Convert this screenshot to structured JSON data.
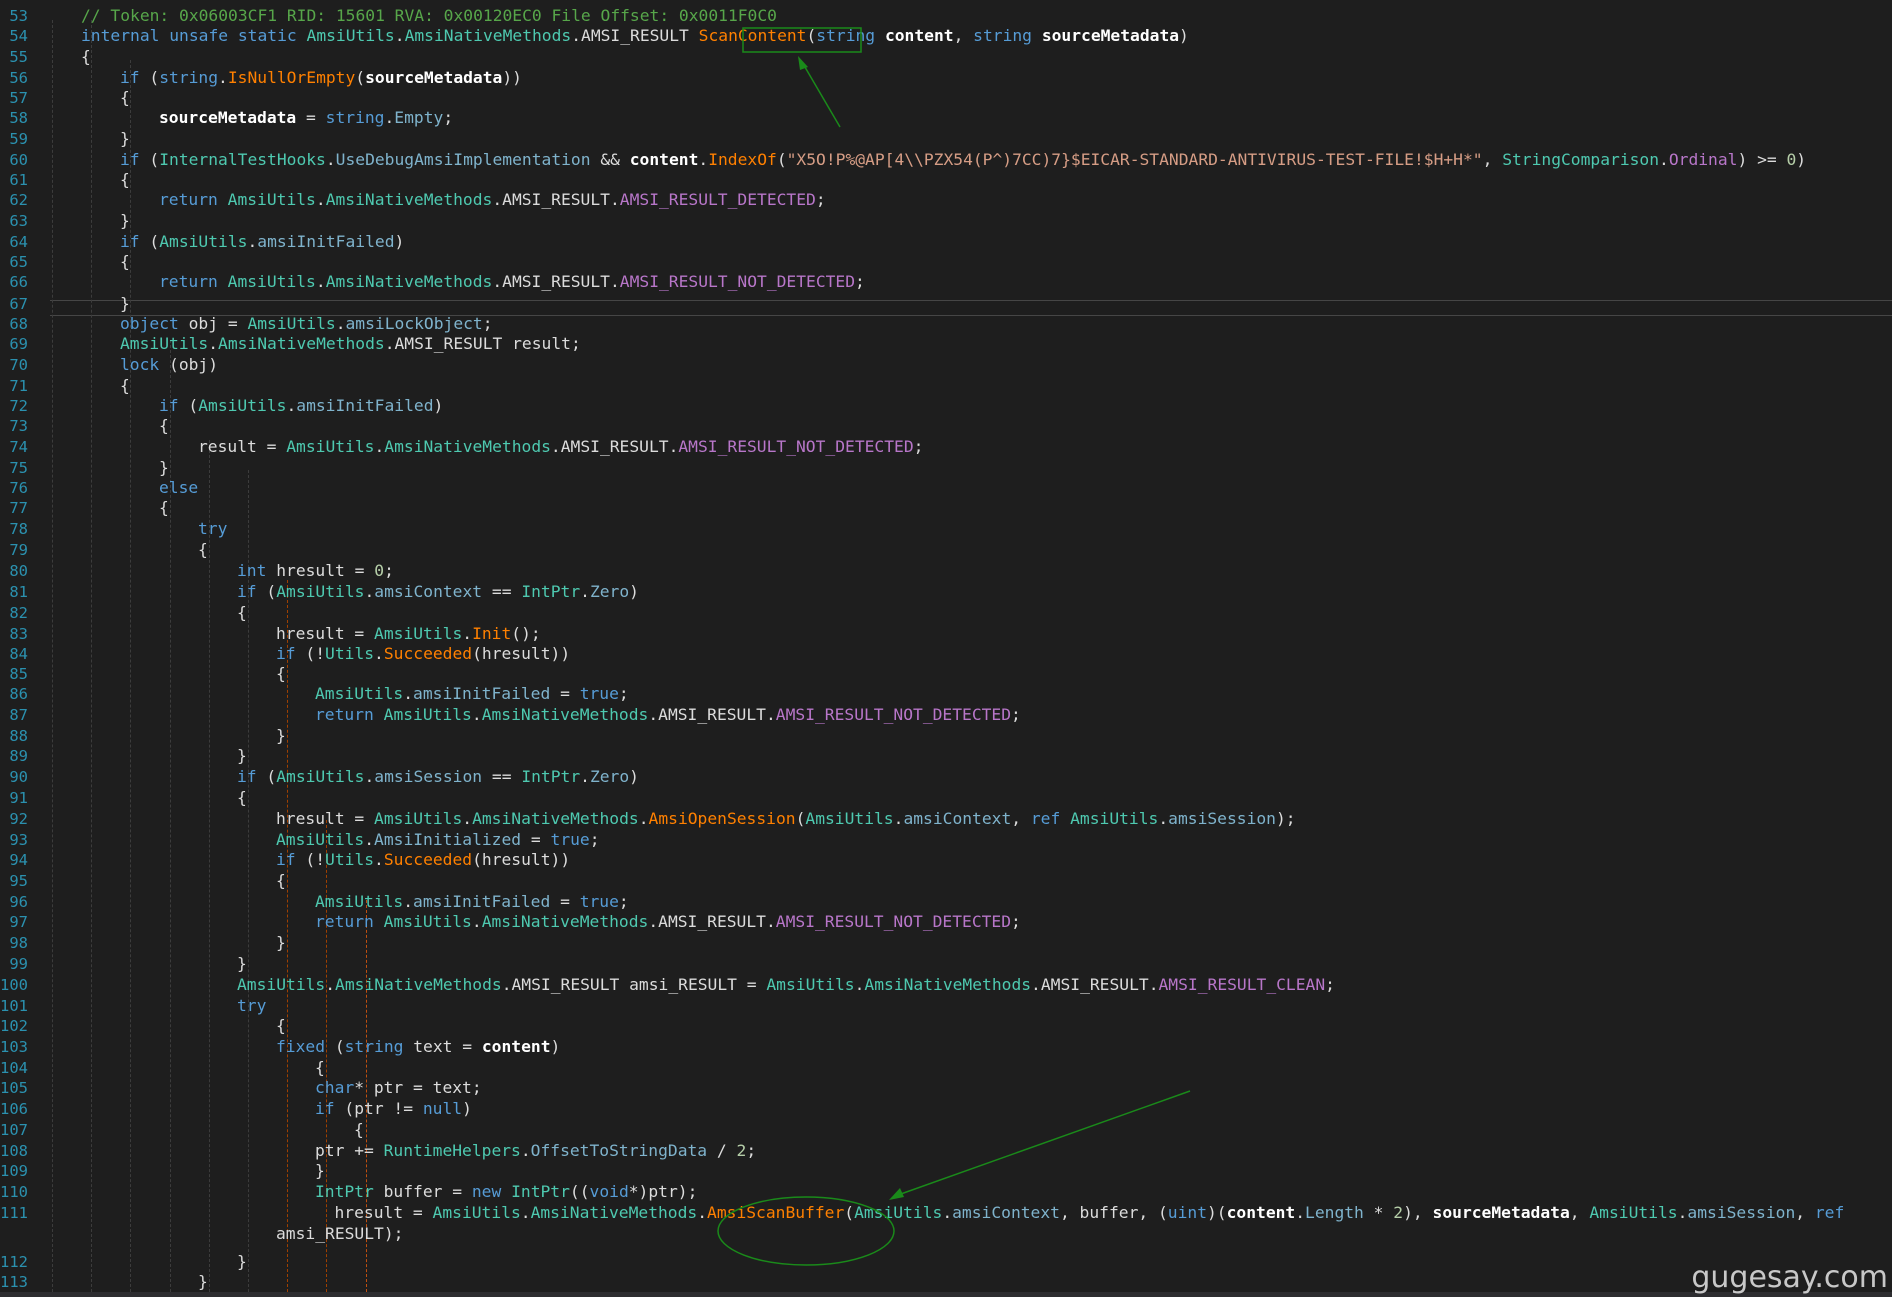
{
  "editor": {
    "line_numbers": [
      "53",
      "54",
      "55",
      "56",
      "57",
      "58",
      "59",
      "60",
      "61",
      "62",
      "63",
      "64",
      "65",
      "66",
      "67",
      "68",
      "69",
      "70",
      "71",
      "72",
      "73",
      "74",
      "75",
      "76",
      "77",
      "78",
      "79",
      "80",
      "81",
      "82",
      "83",
      "84",
      "85",
      "86",
      "87",
      "88",
      "89",
      "90",
      "91",
      "92",
      "93",
      "94",
      "95",
      "96",
      "97",
      "98",
      "99",
      "100",
      "101",
      "102",
      "103",
      "104",
      "105",
      "106",
      "107",
      "108",
      "109",
      "110",
      "111",
      "",
      "112",
      "113"
    ],
    "lines": [
      [
        [
          "cmt",
          "// Token: 0x06003CF1 RID: 15601 RVA: 0x00120EC0 File Offset: 0x0011F0C0"
        ]
      ],
      [
        [
          "kw",
          "internal"
        ],
        [
          "plain",
          " "
        ],
        [
          "kw",
          "unsafe"
        ],
        [
          "plain",
          " "
        ],
        [
          "kw",
          "static"
        ],
        [
          "plain",
          " "
        ],
        [
          "type",
          "AmsiUtils"
        ],
        [
          "plain",
          "."
        ],
        [
          "type",
          "AmsiNativeMethods"
        ],
        [
          "plain",
          "."
        ],
        [
          "plain",
          "AMSI_RESULT "
        ],
        [
          "meth",
          "ScanContent"
        ],
        [
          "plain",
          "("
        ],
        [
          "kw",
          "string"
        ],
        [
          "plain",
          " "
        ],
        [
          "bold",
          "content"
        ],
        [
          "plain",
          ", "
        ],
        [
          "kw",
          "string"
        ],
        [
          "plain",
          " "
        ],
        [
          "bold",
          "sourceMetadata"
        ],
        [
          "plain",
          ")"
        ]
      ],
      [
        [
          "plain",
          "{"
        ]
      ],
      [
        [
          "kw",
          "if"
        ],
        [
          "plain",
          " ("
        ],
        [
          "kw",
          "string"
        ],
        [
          "plain",
          "."
        ],
        [
          "meth",
          "IsNullOrEmpty"
        ],
        [
          "plain",
          "("
        ],
        [
          "bold",
          "sourceMetadata"
        ],
        [
          "plain",
          "))"
        ]
      ],
      [
        [
          "plain",
          "{"
        ]
      ],
      [
        [
          "bold",
          "sourceMetadata"
        ],
        [
          "plain",
          " = "
        ],
        [
          "kw",
          "string"
        ],
        [
          "plain",
          "."
        ],
        [
          "fld",
          "Empty"
        ],
        [
          "plain",
          ";"
        ]
      ],
      [
        [
          "plain",
          "}"
        ]
      ],
      [
        [
          "kw",
          "if"
        ],
        [
          "plain",
          " ("
        ],
        [
          "type",
          "InternalTestHooks"
        ],
        [
          "plain",
          "."
        ],
        [
          "fld",
          "UseDebugAmsiImplementation"
        ],
        [
          "plain",
          " && "
        ],
        [
          "bold",
          "content"
        ],
        [
          "plain",
          "."
        ],
        [
          "meth",
          "IndexOf"
        ],
        [
          "plain",
          "("
        ],
        [
          "str",
          "\"X5O!P%@AP[4\\\\PZX54(P^)7CC)7}$EICAR-STANDARD-ANTIVIRUS-TEST-FILE!$H+H*\""
        ],
        [
          "plain",
          ", "
        ],
        [
          "type",
          "StringComparison"
        ],
        [
          "plain",
          "."
        ],
        [
          "en",
          "Ordinal"
        ],
        [
          "plain",
          ") >= "
        ],
        [
          "num",
          "0"
        ],
        [
          "plain",
          ")"
        ]
      ],
      [
        [
          "plain",
          "{"
        ]
      ],
      [
        [
          "kw",
          "return"
        ],
        [
          "plain",
          " "
        ],
        [
          "type",
          "AmsiUtils"
        ],
        [
          "plain",
          "."
        ],
        [
          "type",
          "AmsiNativeMethods"
        ],
        [
          "plain",
          "."
        ],
        [
          "plain",
          "AMSI_RESULT"
        ],
        [
          "plain",
          "."
        ],
        [
          "en",
          "AMSI_RESULT_DETECTED"
        ],
        [
          "plain",
          ";"
        ]
      ],
      [
        [
          "plain",
          "}"
        ]
      ],
      [
        [
          "kw",
          "if"
        ],
        [
          "plain",
          " ("
        ],
        [
          "type",
          "AmsiUtils"
        ],
        [
          "plain",
          "."
        ],
        [
          "fld",
          "amsiInitFailed"
        ],
        [
          "plain",
          ")"
        ]
      ],
      [
        [
          "plain",
          "{"
        ]
      ],
      [
        [
          "kw",
          "return"
        ],
        [
          "plain",
          " "
        ],
        [
          "type",
          "AmsiUtils"
        ],
        [
          "plain",
          "."
        ],
        [
          "type",
          "AmsiNativeMethods"
        ],
        [
          "plain",
          "."
        ],
        [
          "plain",
          "AMSI_RESULT"
        ],
        [
          "plain",
          "."
        ],
        [
          "en",
          "AMSI_RESULT_NOT_DETECTED"
        ],
        [
          "plain",
          ";"
        ]
      ],
      [
        [
          "plain",
          "}"
        ]
      ],
      [
        [
          "kw",
          "object"
        ],
        [
          "plain",
          " obj = "
        ],
        [
          "type",
          "AmsiUtils"
        ],
        [
          "plain",
          "."
        ],
        [
          "fld",
          "amsiLockObject"
        ],
        [
          "plain",
          ";"
        ]
      ],
      [
        [
          "type",
          "AmsiUtils"
        ],
        [
          "plain",
          "."
        ],
        [
          "type",
          "AmsiNativeMethods"
        ],
        [
          "plain",
          "."
        ],
        [
          "plain",
          "AMSI_RESULT result;"
        ]
      ],
      [
        [
          "kw",
          "lock"
        ],
        [
          "plain",
          " (obj)"
        ]
      ],
      [
        [
          "plain",
          "{"
        ]
      ],
      [
        [
          "kw",
          "if"
        ],
        [
          "plain",
          " ("
        ],
        [
          "type",
          "AmsiUtils"
        ],
        [
          "plain",
          "."
        ],
        [
          "fld",
          "amsiInitFailed"
        ],
        [
          "plain",
          ")"
        ]
      ],
      [
        [
          "plain",
          "{"
        ]
      ],
      [
        [
          "plain",
          "result = "
        ],
        [
          "type",
          "AmsiUtils"
        ],
        [
          "plain",
          "."
        ],
        [
          "type",
          "AmsiNativeMethods"
        ],
        [
          "plain",
          "."
        ],
        [
          "plain",
          "AMSI_RESULT"
        ],
        [
          "plain",
          "."
        ],
        [
          "en",
          "AMSI_RESULT_NOT_DETECTED"
        ],
        [
          "plain",
          ";"
        ]
      ],
      [
        [
          "plain",
          "}"
        ]
      ],
      [
        [
          "kw",
          "else"
        ]
      ],
      [
        [
          "plain",
          "{"
        ]
      ],
      [
        [
          "kw",
          "try"
        ]
      ],
      [
        [
          "plain",
          "{"
        ]
      ],
      [
        [
          "kw",
          "int"
        ],
        [
          "plain",
          " hresult = "
        ],
        [
          "num",
          "0"
        ],
        [
          "plain",
          ";"
        ]
      ],
      [
        [
          "kw",
          "if"
        ],
        [
          "plain",
          " ("
        ],
        [
          "type",
          "AmsiUtils"
        ],
        [
          "plain",
          "."
        ],
        [
          "fld",
          "amsiContext"
        ],
        [
          "plain",
          " == "
        ],
        [
          "ref",
          "IntPtr"
        ],
        [
          "plain",
          "."
        ],
        [
          "fld",
          "Zero"
        ],
        [
          "plain",
          ")"
        ]
      ],
      [
        [
          "plain",
          "{"
        ]
      ],
      [
        [
          "plain",
          "hresult = "
        ],
        [
          "type",
          "AmsiUtils"
        ],
        [
          "plain",
          "."
        ],
        [
          "meth",
          "Init"
        ],
        [
          "plain",
          "();"
        ]
      ],
      [
        [
          "kw",
          "if"
        ],
        [
          "plain",
          " (!"
        ],
        [
          "type",
          "Utils"
        ],
        [
          "plain",
          "."
        ],
        [
          "meth",
          "Succeeded"
        ],
        [
          "plain",
          "(hresult))"
        ]
      ],
      [
        [
          "plain",
          "{"
        ]
      ],
      [
        [
          "type",
          "AmsiUtils"
        ],
        [
          "plain",
          "."
        ],
        [
          "fld",
          "amsiInitFailed"
        ],
        [
          "plain",
          " = "
        ],
        [
          "kw",
          "true"
        ],
        [
          "plain",
          ";"
        ]
      ],
      [
        [
          "kw",
          "return"
        ],
        [
          "plain",
          " "
        ],
        [
          "type",
          "AmsiUtils"
        ],
        [
          "plain",
          "."
        ],
        [
          "type",
          "AmsiNativeMethods"
        ],
        [
          "plain",
          "."
        ],
        [
          "plain",
          "AMSI_RESULT"
        ],
        [
          "plain",
          "."
        ],
        [
          "en",
          "AMSI_RESULT_NOT_DETECTED"
        ],
        [
          "plain",
          ";"
        ]
      ],
      [
        [
          "plain",
          "}"
        ]
      ],
      [
        [
          "plain",
          "}"
        ]
      ],
      [
        [
          "kw",
          "if"
        ],
        [
          "plain",
          " ("
        ],
        [
          "type",
          "AmsiUtils"
        ],
        [
          "plain",
          "."
        ],
        [
          "fld",
          "amsiSession"
        ],
        [
          "plain",
          " == "
        ],
        [
          "ref",
          "IntPtr"
        ],
        [
          "plain",
          "."
        ],
        [
          "fld",
          "Zero"
        ],
        [
          "plain",
          ")"
        ]
      ],
      [
        [
          "plain",
          "{"
        ]
      ],
      [
        [
          "plain",
          "hresult = "
        ],
        [
          "type",
          "AmsiUtils"
        ],
        [
          "plain",
          "."
        ],
        [
          "type",
          "AmsiNativeMethods"
        ],
        [
          "plain",
          "."
        ],
        [
          "meth",
          "AmsiOpenSession"
        ],
        [
          "plain",
          "("
        ],
        [
          "type",
          "AmsiUtils"
        ],
        [
          "plain",
          "."
        ],
        [
          "fld",
          "amsiContext"
        ],
        [
          "plain",
          ", "
        ],
        [
          "kw",
          "ref"
        ],
        [
          "plain",
          " "
        ],
        [
          "type",
          "AmsiUtils"
        ],
        [
          "plain",
          "."
        ],
        [
          "fld",
          "amsiSession"
        ],
        [
          "plain",
          ");"
        ]
      ],
      [
        [
          "type",
          "AmsiUtils"
        ],
        [
          "plain",
          "."
        ],
        [
          "fld",
          "AmsiInitialized"
        ],
        [
          "plain",
          " = "
        ],
        [
          "kw",
          "true"
        ],
        [
          "plain",
          ";"
        ]
      ],
      [
        [
          "kw",
          "if"
        ],
        [
          "plain",
          " (!"
        ],
        [
          "type",
          "Utils"
        ],
        [
          "plain",
          "."
        ],
        [
          "meth",
          "Succeeded"
        ],
        [
          "plain",
          "(hresult))"
        ]
      ],
      [
        [
          "plain",
          "{"
        ]
      ],
      [
        [
          "type",
          "AmsiUtils"
        ],
        [
          "plain",
          "."
        ],
        [
          "fld",
          "amsiInitFailed"
        ],
        [
          "plain",
          " = "
        ],
        [
          "kw",
          "true"
        ],
        [
          "plain",
          ";"
        ]
      ],
      [
        [
          "kw",
          "return"
        ],
        [
          "plain",
          " "
        ],
        [
          "type",
          "AmsiUtils"
        ],
        [
          "plain",
          "."
        ],
        [
          "type",
          "AmsiNativeMethods"
        ],
        [
          "plain",
          "."
        ],
        [
          "plain",
          "AMSI_RESULT"
        ],
        [
          "plain",
          "."
        ],
        [
          "en",
          "AMSI_RESULT_NOT_DETECTED"
        ],
        [
          "plain",
          ";"
        ]
      ],
      [
        [
          "plain",
          "}"
        ]
      ],
      [
        [
          "plain",
          "}"
        ]
      ],
      [
        [
          "type",
          "AmsiUtils"
        ],
        [
          "plain",
          "."
        ],
        [
          "type",
          "AmsiNativeMethods"
        ],
        [
          "plain",
          "."
        ],
        [
          "plain",
          "AMSI_RESULT amsi_RESULT = "
        ],
        [
          "type",
          "AmsiUtils"
        ],
        [
          "plain",
          "."
        ],
        [
          "type",
          "AmsiNativeMethods"
        ],
        [
          "plain",
          "."
        ],
        [
          "plain",
          "AMSI_RESULT"
        ],
        [
          "plain",
          "."
        ],
        [
          "en",
          "AMSI_RESULT_CLEAN"
        ],
        [
          "plain",
          ";"
        ]
      ],
      [
        [
          "kw",
          "try"
        ]
      ],
      [
        [
          "plain",
          "{"
        ]
      ],
      [
        [
          "kw",
          "fixed"
        ],
        [
          "plain",
          " ("
        ],
        [
          "kw",
          "string"
        ],
        [
          "plain",
          " text = "
        ],
        [
          "bold",
          "content"
        ],
        [
          "plain",
          ")"
        ]
      ],
      [
        [
          "plain",
          "{"
        ]
      ],
      [
        [
          "kw",
          "char"
        ],
        [
          "plain",
          "* ptr = text;"
        ]
      ],
      [
        [
          "kw",
          "if"
        ],
        [
          "plain",
          " (ptr != "
        ],
        [
          "kw",
          "null"
        ],
        [
          "plain",
          ")"
        ]
      ],
      [
        [
          "plain",
          "{"
        ]
      ],
      [
        [
          "plain",
          "ptr += "
        ],
        [
          "ref",
          "RuntimeHelpers"
        ],
        [
          "plain",
          "."
        ],
        [
          "fld",
          "OffsetToStringData"
        ],
        [
          "plain",
          " / "
        ],
        [
          "num",
          "2"
        ],
        [
          "plain",
          ";"
        ]
      ],
      [
        [
          "plain",
          "}"
        ]
      ],
      [
        [
          "ref",
          "IntPtr"
        ],
        [
          "plain",
          " buffer = "
        ],
        [
          "kw",
          "new"
        ],
        [
          "plain",
          " "
        ],
        [
          "ref",
          "IntPtr"
        ],
        [
          "plain",
          "(("
        ],
        [
          "kw",
          "void"
        ],
        [
          "plain",
          "*)ptr);"
        ]
      ],
      [
        [
          "plain",
          "hresult = "
        ],
        [
          "type",
          "AmsiUtils"
        ],
        [
          "plain",
          "."
        ],
        [
          "type",
          "AmsiNativeMethods"
        ],
        [
          "plain",
          "."
        ],
        [
          "meth",
          "AmsiScanBuffer"
        ],
        [
          "plain",
          "("
        ],
        [
          "type",
          "AmsiUtils"
        ],
        [
          "plain",
          "."
        ],
        [
          "fld",
          "amsiContext"
        ],
        [
          "plain",
          ", buffer, ("
        ],
        [
          "kw",
          "uint"
        ],
        [
          "plain",
          ")("
        ],
        [
          "bold",
          "content"
        ],
        [
          "plain",
          "."
        ],
        [
          "fld",
          "Length"
        ],
        [
          "plain",
          " * "
        ],
        [
          "num",
          "2"
        ],
        [
          "plain",
          "), "
        ],
        [
          "bold",
          "sourceMetadata"
        ],
        [
          "plain",
          ", "
        ],
        [
          "type",
          "AmsiUtils"
        ],
        [
          "plain",
          "."
        ],
        [
          "fld",
          "amsiSession"
        ],
        [
          "plain",
          ", "
        ],
        [
          "kw",
          "ref"
        ]
      ],
      [
        [
          "plain",
          "amsi_RESULT);"
        ]
      ],
      [
        [
          "plain",
          "}"
        ]
      ],
      [
        [
          "plain",
          "}"
        ]
      ]
    ]
  },
  "watermark": "gugesay.com",
  "annotation_color": "#1a8a1a"
}
